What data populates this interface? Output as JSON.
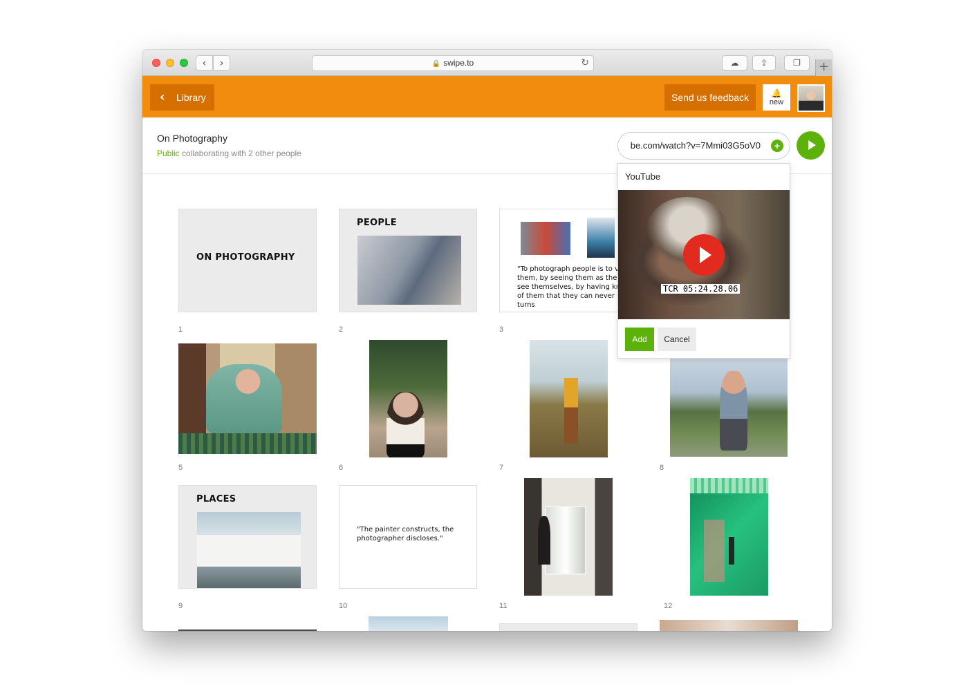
{
  "browser": {
    "url": "swipe.to",
    "lock_icon": "lock-icon",
    "back_glyph": "‹",
    "forward_glyph": "›",
    "reload_glyph": "↻",
    "cloud_glyph": "☁",
    "share_glyph": "⇪",
    "tabs_glyph": "❐",
    "newtab_glyph": "+"
  },
  "topbar": {
    "library_label": "Library",
    "feedback_label": "Send us feedback",
    "notification_label": "new",
    "accent_color": "#f18c0e"
  },
  "deck": {
    "title": "On Photography",
    "visibility": "Public",
    "collaboration": " collaborating with 2 other people"
  },
  "media_input": {
    "value": "be.com/watch?v=7Mmi03G5oV0",
    "add_glyph": "+"
  },
  "popover": {
    "title": "YouTube",
    "timecode": "TCR 05:24.28.06",
    "add_label": "Add",
    "cancel_label": "Cancel"
  },
  "slides": [
    {
      "number": "1",
      "heading": "ON PHOTOGRAPHY"
    },
    {
      "number": "2",
      "heading": "PEOPLE"
    },
    {
      "number": "3",
      "quote": "\"To photograph people is to violate them, by seeing them as they never see themselves, by having knowledge of them that they can never have; it turns"
    },
    {
      "number": "5"
    },
    {
      "number": "6"
    },
    {
      "number": "7"
    },
    {
      "number": "8"
    },
    {
      "number": "9",
      "heading": "PLACES"
    },
    {
      "number": "10",
      "quote": "\"The painter constructs, the photographer discloses.\""
    },
    {
      "number": "11"
    },
    {
      "number": "12"
    }
  ]
}
